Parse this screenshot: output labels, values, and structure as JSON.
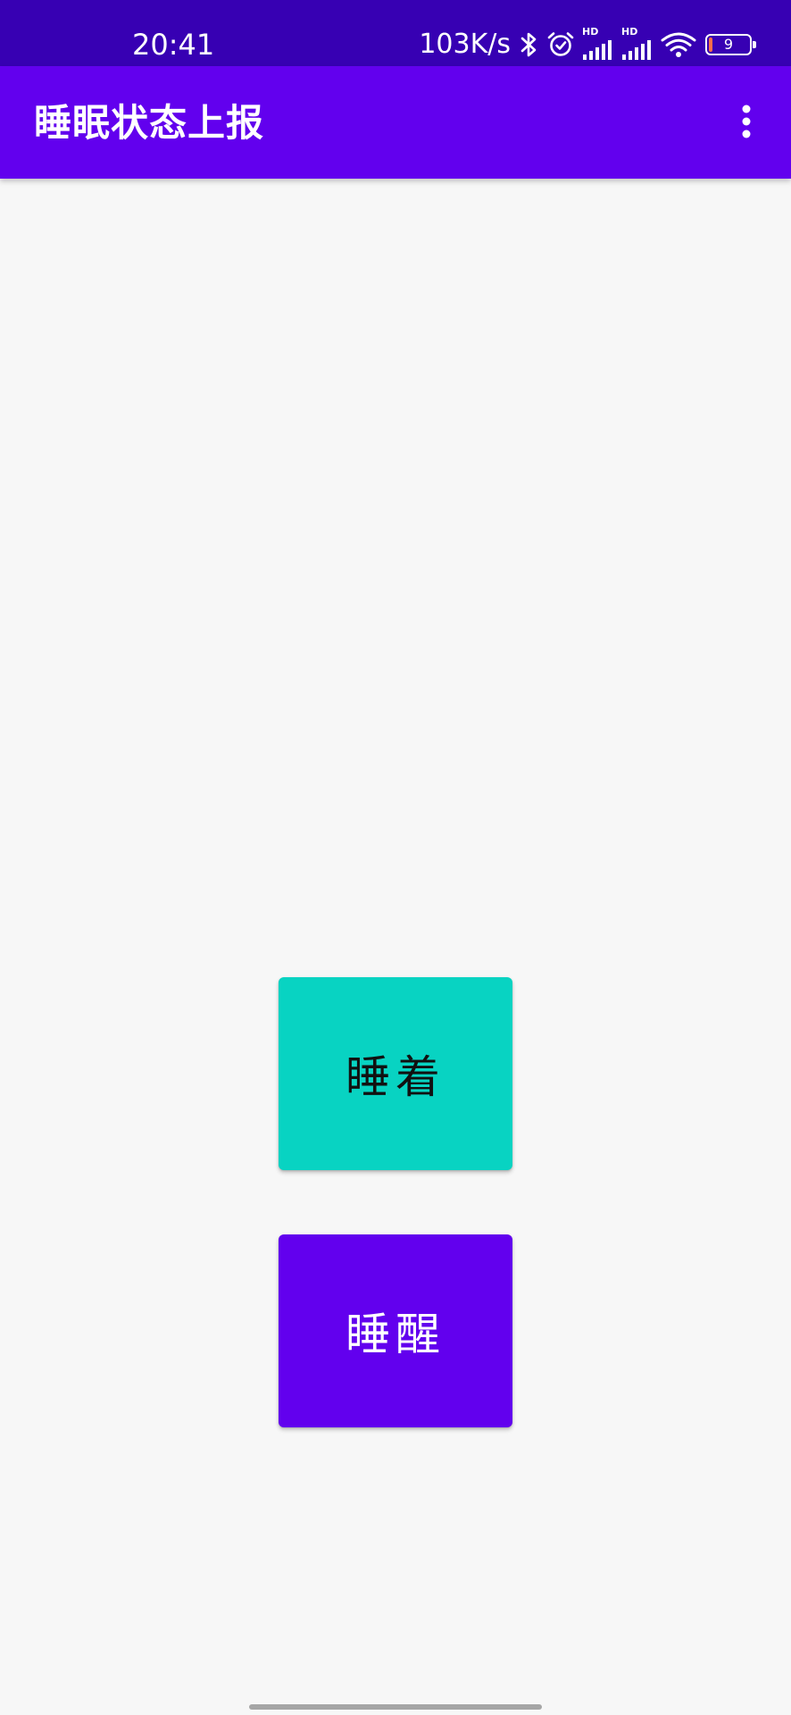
{
  "status_bar": {
    "time": "20:41",
    "net_speed": "103K/s",
    "battery_level": "9",
    "icons": [
      "bluetooth-icon",
      "alarm-icon",
      "hd-signal-icon",
      "hd-signal-icon",
      "wifi-icon",
      "battery-icon"
    ]
  },
  "app_bar": {
    "title": "睡眠状态上报",
    "overflow_icon": "more-vert-icon"
  },
  "buttons": {
    "asleep_label": "睡着",
    "awake_label": "睡醒"
  },
  "colors": {
    "status_bar": "#3700b3",
    "primary": "#6200ee",
    "asleep_button": "#08d3c2",
    "background": "#f7f7f7"
  }
}
